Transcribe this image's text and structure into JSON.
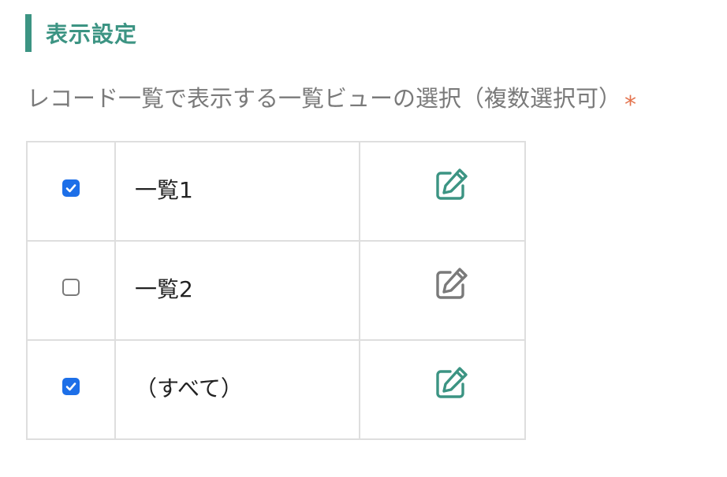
{
  "section": {
    "title": "表示設定"
  },
  "description": {
    "text": "レコード一覧で表示する一覧ビューの選択（複数選択可）",
    "required_mark": "*"
  },
  "colors": {
    "accent": "#3c9483",
    "required": "#e4744e",
    "checkbox_checked": "#1d6fe8",
    "icon_inactive": "#7a7a7a"
  },
  "views": [
    {
      "name": "一覧1",
      "checked": true,
      "edit_icon": "edit-icon"
    },
    {
      "name": "一覧2",
      "checked": false,
      "edit_icon": "edit-icon"
    },
    {
      "name": "（すべて）",
      "checked": true,
      "edit_icon": "edit-icon"
    }
  ]
}
